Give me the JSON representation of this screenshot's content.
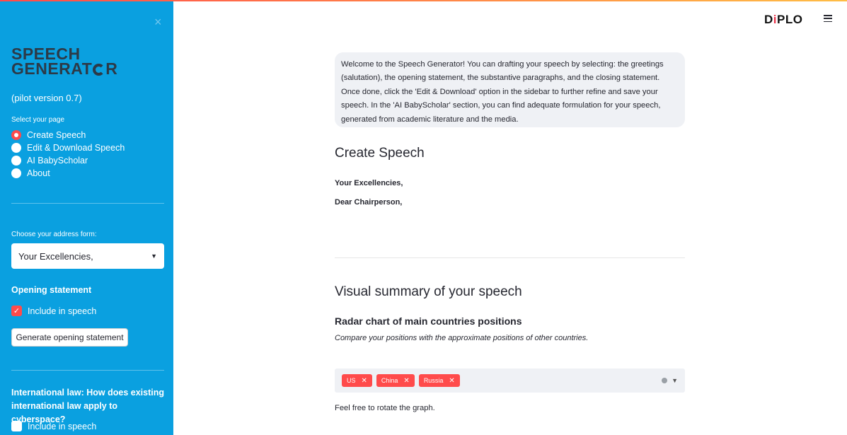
{
  "sidebar": {
    "close_glyph": "×",
    "logo": {
      "line1": "SPEECH",
      "line2_prefix": "GENERAT",
      "line2_suffix": "R"
    },
    "version": "(pilot version 0.7)",
    "page_select_label": "Select your page",
    "pages": [
      {
        "label": "Create Speech",
        "selected": true
      },
      {
        "label": "Edit & Download Speech",
        "selected": false
      },
      {
        "label": "AI BabyScholar",
        "selected": false
      },
      {
        "label": "About",
        "selected": false
      }
    ],
    "address_label": "Choose your address form:",
    "address_value": "Your Excellencies,",
    "opening_title": "Opening statement",
    "include_label": "Include in speech",
    "opening_include_checked": true,
    "generate_button": "Generate opening statement",
    "intl_title": "International law: How does existing international law apply to cyberspace?",
    "intl_include_label": "Include in speech",
    "intl_include_checked": false
  },
  "header": {
    "brand_d": "D",
    "brand_i": "i",
    "brand_rest": "PLO",
    "menu_icon": "hamburger-icon"
  },
  "main": {
    "info_text": "Welcome to the Speech Generator! You can drafting your speech by selecting: the greetings (salutation), the opening statement, the substantive paragraphs, and the closing statement. Once done, click the 'Edit & Download' option in the sidebar to further refine and save your speech. In the 'AI BabyScholar' section, you can find adequate formulation for your speech, generated from academic literature and the media.",
    "create_title": "Create Speech",
    "salutation1": "Your Excellencies,",
    "salutation2": "Dear Chairperson,",
    "visual_title": "Visual summary of your speech",
    "radar_title": "Radar chart of main countries positions",
    "radar_caption": "Compare your positions with the approximate positions of other countries.",
    "countries": [
      "US",
      "China",
      "Russia"
    ],
    "rotate_text": "Feel free to rotate the graph."
  },
  "colors": {
    "sidebar_bg": "#0aa0e0",
    "accent": "#ff4b4b",
    "logo_text": "#2c3a48"
  }
}
